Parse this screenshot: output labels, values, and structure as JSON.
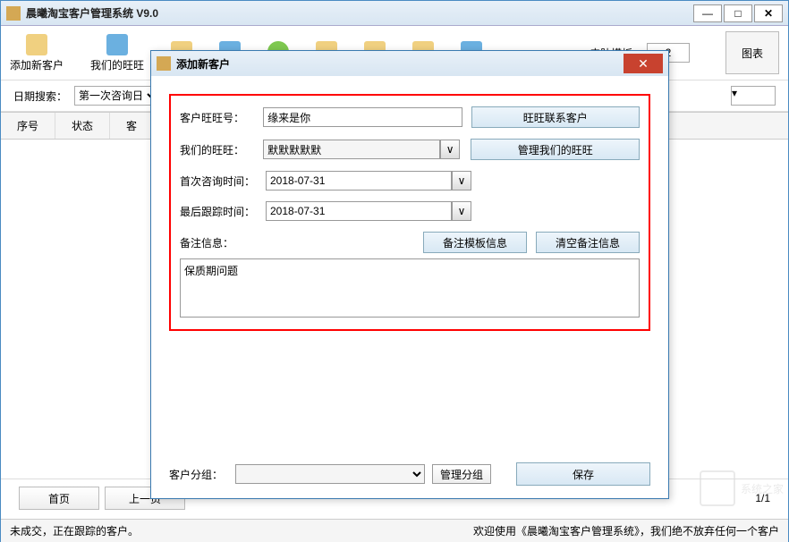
{
  "main": {
    "title": "晨曦淘宝客户管理系统  V9.0",
    "window_controls": {
      "min": "—",
      "max": "□",
      "close": "✕"
    }
  },
  "toolbar": {
    "items": [
      {
        "label": "添加新客户"
      },
      {
        "label": "我们的旺旺"
      },
      {
        "label": ""
      },
      {
        "label": ""
      },
      {
        "label": ""
      },
      {
        "label": ""
      },
      {
        "label": ""
      },
      {
        "label": ""
      },
      {
        "label": ""
      }
    ],
    "skin_label": "皮肤模板：",
    "skin_value": "2",
    "chart_label": "图表"
  },
  "search": {
    "date_label": "日期搜索：",
    "date_option": "第一次咨询日"
  },
  "table": {
    "headers": [
      "序号",
      "状态",
      "客"
    ]
  },
  "pagination": {
    "first": "首页",
    "prev": "上一页",
    "info": "1/1"
  },
  "status": {
    "left": "未成交，正在跟踪的客户。",
    "welcome": "欢迎使用《晨曦淘宝客户管理系统》，我们绝不放弃任何一个客户"
  },
  "dialog": {
    "title": "添加新客户",
    "close": "✕",
    "labels": {
      "customer_ww": "客户旺旺号：",
      "our_ww": "我们的旺旺：",
      "first_time": "首次咨询时间：",
      "last_time": "最后跟踪时间：",
      "note": "备注信息：",
      "group": "客户分组："
    },
    "values": {
      "customer_ww": "缘来是你",
      "our_ww": "默默默默默",
      "first_time": "2018-07-31",
      "last_time": "2018-07-31",
      "note": "保质期问题",
      "group": ""
    },
    "buttons": {
      "contact": "旺旺联系客户",
      "manage_ww": "管理我们的旺旺",
      "note_template": "备注模板信息",
      "clear_note": "清空备注信息",
      "manage_group": "管理分组",
      "save": "保存"
    },
    "dropdown_glyph": "∨"
  },
  "watermark": "系统之家"
}
